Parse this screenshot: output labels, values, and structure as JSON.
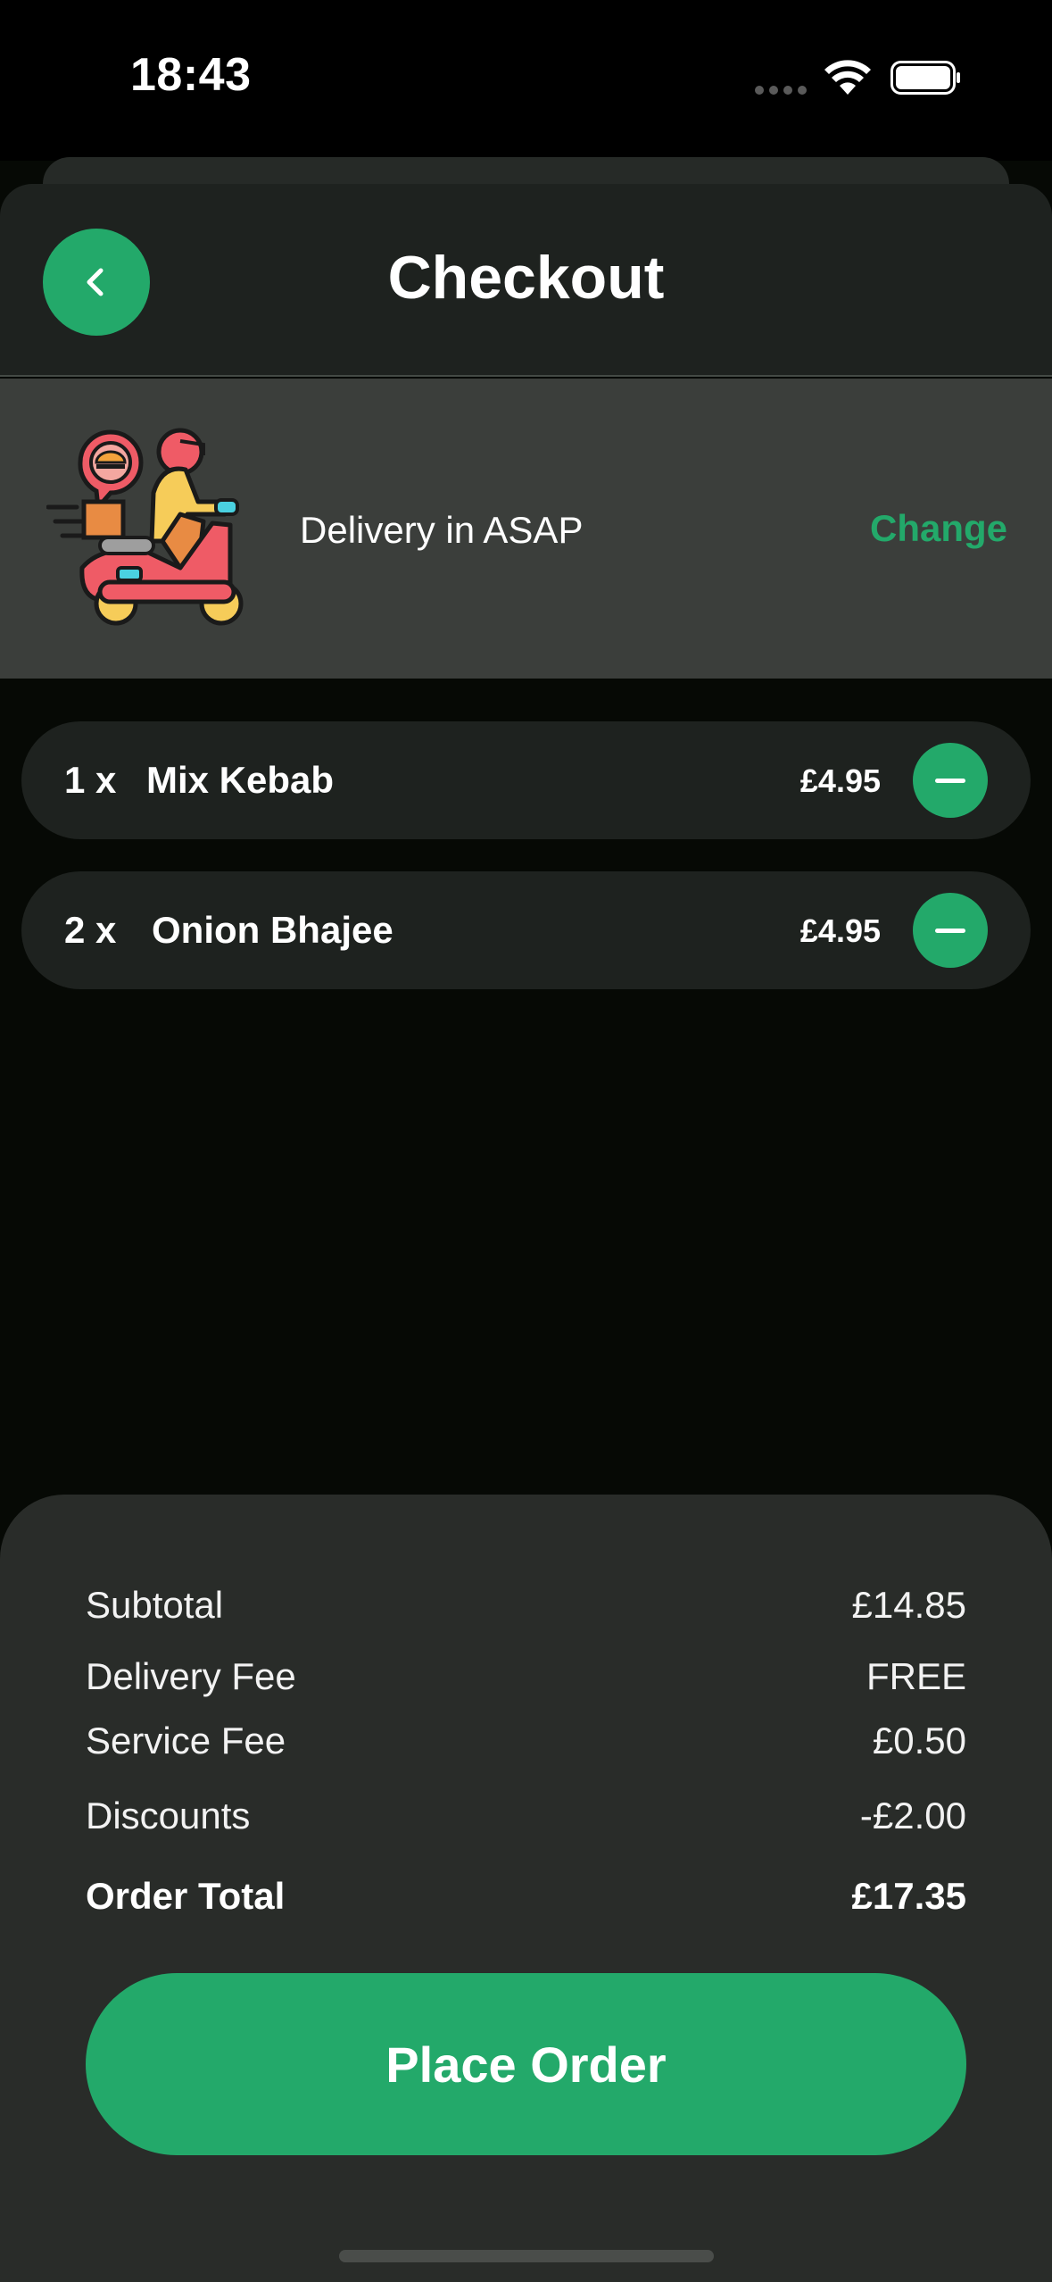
{
  "status_bar": {
    "time": "18:43"
  },
  "header": {
    "title": "Checkout"
  },
  "delivery": {
    "text": "Delivery in ASAP",
    "change_label": "Change"
  },
  "items": [
    {
      "qty": "1 x",
      "name": "Mix Kebab",
      "price": "£4.95"
    },
    {
      "qty": "2 x",
      "name": "Onion Bhajee",
      "price": "£4.95"
    }
  ],
  "summary": {
    "subtotal_label": "Subtotal",
    "subtotal_value": "£14.85",
    "delivery_fee_label": "Delivery Fee",
    "delivery_fee_value": "FREE",
    "service_fee_label": "Service Fee",
    "service_fee_value": "£0.50",
    "discounts_label": "Discounts",
    "discounts_value": "-£2.00",
    "total_label": "Order Total",
    "total_value": "£17.35"
  },
  "place_order_label": "Place Order",
  "icons": {
    "back": "chevron-left-icon",
    "remove": "minus-icon",
    "delivery": "scooter-delivery-icon"
  },
  "colors": {
    "accent": "#23a96a",
    "background": "#060905",
    "card": "#1e221f",
    "banner": "#3b3e3b",
    "panel": "#292c29"
  }
}
